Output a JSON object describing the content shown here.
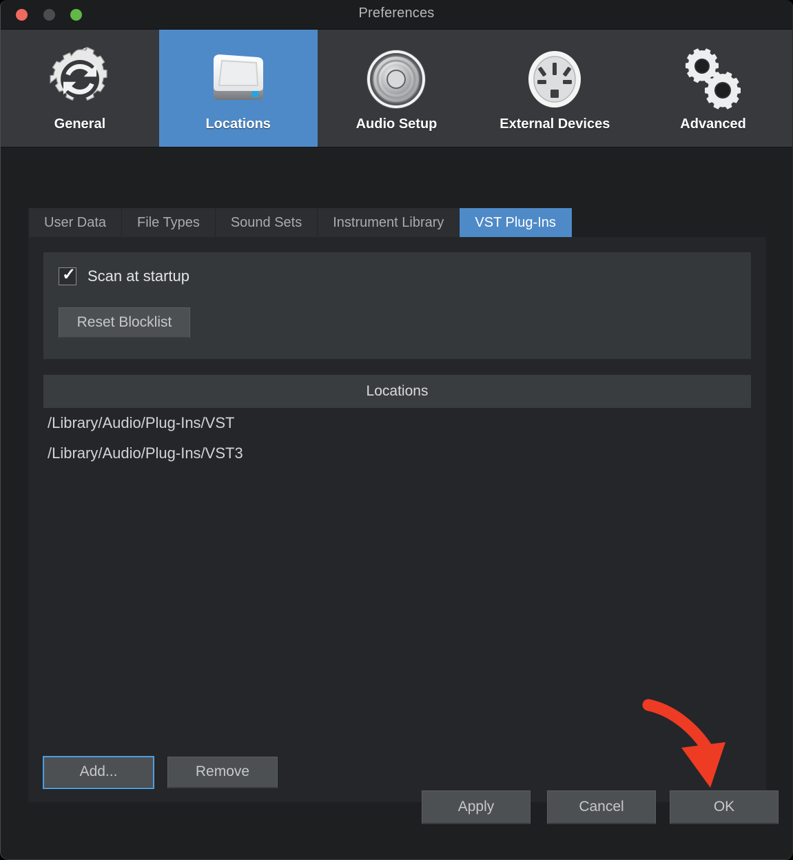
{
  "window": {
    "title": "Preferences",
    "traffic_lights": [
      {
        "name": "close",
        "color": "#ed6a5f"
      },
      {
        "name": "minimize",
        "color": "#4a4c4e"
      },
      {
        "name": "zoom",
        "color": "#62b847"
      }
    ]
  },
  "toolbar": {
    "selected": "Locations",
    "accent_color": "#4f8ac8",
    "items": [
      {
        "label": "General",
        "icon": "gear-refresh-icon"
      },
      {
        "label": "Locations",
        "icon": "hard-drive-icon"
      },
      {
        "label": "Audio Setup",
        "icon": "speaker-driver-icon"
      },
      {
        "label": "External Devices",
        "icon": "power-socket-icon"
      },
      {
        "label": "Advanced",
        "icon": "двойной-gears-icon"
      }
    ]
  },
  "tabs": {
    "active": "VST Plug-Ins",
    "items": [
      {
        "label": "User Data"
      },
      {
        "label": "File Types"
      },
      {
        "label": "Sound Sets"
      },
      {
        "label": "Instrument Library"
      },
      {
        "label": "VST Plug-Ins"
      }
    ]
  },
  "options": {
    "scan_at_startup": {
      "label": "Scan at startup",
      "checked": true,
      "tick": "✓"
    },
    "reset_blocklist_label": "Reset Blocklist"
  },
  "locations": {
    "header": "Locations",
    "rows": [
      "/Library/Audio/Plug-Ins/VST",
      "/Library/Audio/Plug-Ins/VST3"
    ],
    "add_label": "Add...",
    "remove_label": "Remove"
  },
  "footer": {
    "apply_label": "Apply",
    "cancel_label": "Cancel",
    "ok_label": "OK"
  },
  "annotation": {
    "arrow_color": "#ee3b24",
    "points_to": "OK"
  }
}
